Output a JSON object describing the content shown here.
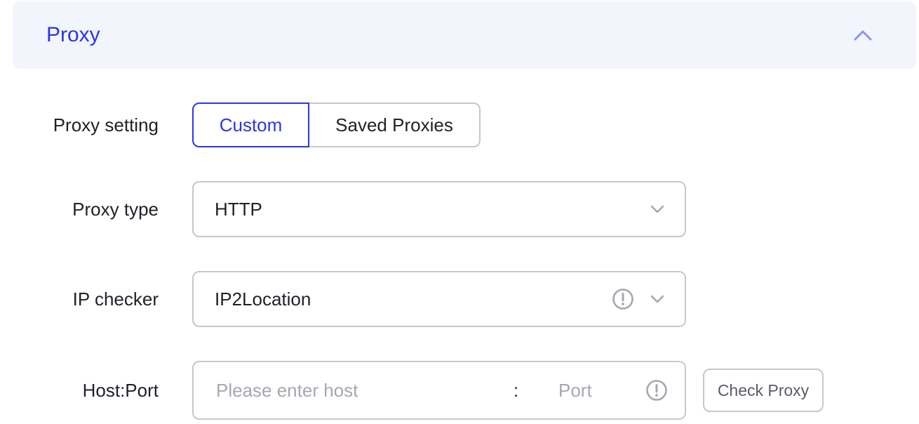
{
  "section": {
    "title": "Proxy"
  },
  "proxy_setting": {
    "label": "Proxy setting",
    "options": [
      "Custom",
      "Saved Proxies"
    ],
    "selected": "Custom"
  },
  "proxy_type": {
    "label": "Proxy type",
    "value": "HTTP"
  },
  "ip_checker": {
    "label": "IP checker",
    "value": "IP2Location"
  },
  "host_port": {
    "label": "Host:Port",
    "host_placeholder": "Please enter host",
    "separator": ":",
    "port_placeholder": "Port"
  },
  "check_button": {
    "label": "Check Proxy"
  },
  "colors": {
    "accent": "#2a36e6",
    "header_bg": "#f3f5fd",
    "border": "#c6c8ce",
    "placeholder": "#a5a8b0"
  },
  "icons": {
    "collapse": "chevron-up-icon",
    "dropdown": "chevron-down-icon",
    "info": "info-circle-icon"
  }
}
